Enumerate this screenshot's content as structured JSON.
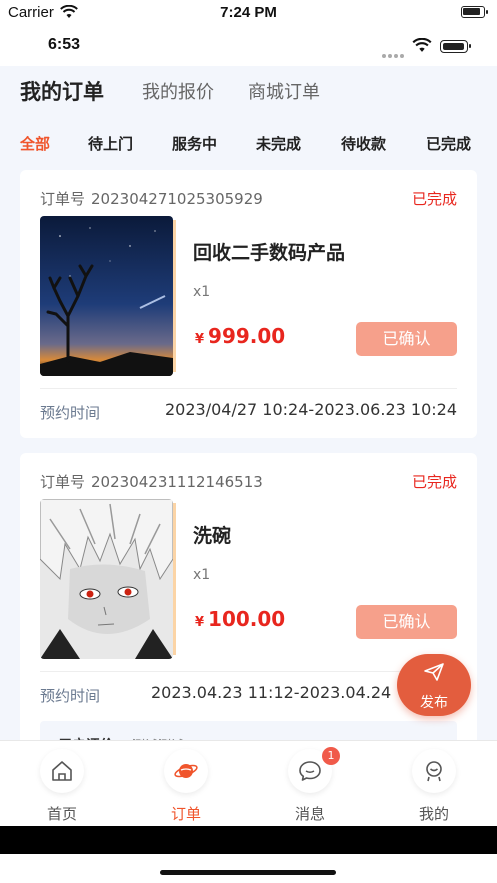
{
  "system": {
    "carrier": "Carrier",
    "time": "7:24 PM",
    "inner_time": "6:53"
  },
  "top_tabs": [
    {
      "label": "我的订单",
      "active": true
    },
    {
      "label": "我的报价",
      "active": false
    },
    {
      "label": "商城订单",
      "active": false
    }
  ],
  "sub_tabs": [
    {
      "label": "全部",
      "active": true
    },
    {
      "label": "待上门",
      "active": false
    },
    {
      "label": "服务中",
      "active": false
    },
    {
      "label": "未完成",
      "active": false
    },
    {
      "label": "待收款",
      "active": false
    },
    {
      "label": "已完成",
      "active": false
    }
  ],
  "orders": [
    {
      "order_no_label": "订单号",
      "order_no": "202304271025305929",
      "status": "已完成",
      "image_icon": "night-sky-tree-photo",
      "product_name": "回收二手数码产品",
      "qty": "x1",
      "currency": "¥",
      "price": "999.00",
      "confirm_label": "已确认",
      "time_label": "预约时间",
      "time_value": "2023/04/27 10:24-2023.06.23 10:24"
    },
    {
      "order_no_label": "订单号",
      "order_no": "202304231112146513",
      "status": "已完成",
      "image_icon": "anime-portrait-photo",
      "product_name": "洗碗",
      "qty": "x1",
      "currency": "¥",
      "price": "100.00",
      "confirm_label": "已确认",
      "time_label": "预约时间",
      "time_value": "2023.04.23 11:12-2023.04.24",
      "remark_label": "用户评价",
      "remark_value": "测试测试"
    }
  ],
  "fab": {
    "label": "发布",
    "icon": "paper-plane-icon"
  },
  "bottom_nav": [
    {
      "label": "首页",
      "icon": "home-icon",
      "active": false
    },
    {
      "label": "订单",
      "icon": "planet-icon",
      "active": true
    },
    {
      "label": "消息",
      "icon": "chat-bubble-icon",
      "active": false,
      "badge": "1"
    },
    {
      "label": "我的",
      "icon": "profile-icon",
      "active": false
    }
  ],
  "colors": {
    "accent": "#f0552c",
    "price": "#e8261e",
    "confirm_button": "#f6a08b",
    "fab": "#e35d3e",
    "page_bg": "#f3f6fc"
  }
}
